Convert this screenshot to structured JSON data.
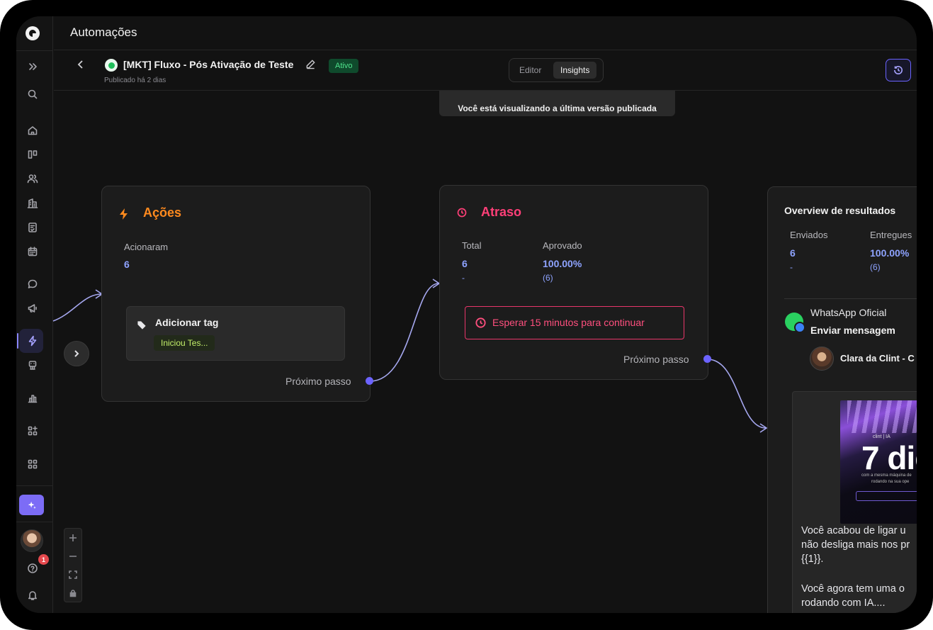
{
  "header": {
    "app_title": "Automações"
  },
  "flow": {
    "name": "[MKT] Fluxo - Pós Ativação de Teste",
    "status": "Ativo",
    "published": "Publicado há 2 dias"
  },
  "view_toggle": {
    "editor": "Editor",
    "insights": "Insights",
    "selected": "Insights"
  },
  "version_notice": "Você está visualizando a última versão publicada",
  "sidebar": {
    "badge_count": "1",
    "icons": [
      "expand-icon",
      "search-icon",
      "home-icon",
      "board-icon",
      "users-icon",
      "building-icon",
      "tasks-icon",
      "calendar-icon",
      "chat-icon",
      "megaphone-icon",
      "automation-icon",
      "bot-icon",
      "chart-icon",
      "apps-add-icon",
      "apps-icon",
      "ai-sparkle-icon",
      "help-icon",
      "bell-icon"
    ],
    "active": "automation-icon"
  },
  "nodes": {
    "acoes": {
      "title": "Ações",
      "label": "Acionaram",
      "value": "6",
      "tag_action": "Adicionar tag",
      "tag_chip": "Iniciou Tes...",
      "next": "Próximo passo",
      "color": "#ff8a1e"
    },
    "atraso": {
      "title": "Atraso",
      "total_label": "Total",
      "total_value": "6",
      "total_sub": "-",
      "approved_label": "Aprovado",
      "approved_value": "100.00%",
      "approved_sub": "(6)",
      "wait_text": "Esperar 15 minutos para continuar",
      "next": "Próximo passo",
      "color": "#ff3f78"
    },
    "overview": {
      "title": "Overview de resultados",
      "sent_label": "Enviados",
      "sent_value": "6",
      "sent_sub": "-",
      "delivered_label": "Entregues",
      "delivered_value": "100.00%",
      "delivered_sub": "(6)",
      "channel": "WhatsApp Oficial",
      "action": "Enviar mensagem",
      "sender": "Clara da Clint - C",
      "promo_brand": "clint | IA",
      "promo_big": "7 dic",
      "promo_small_1": "com a mesma máquina de",
      "promo_small_2": "rodando na sua ope",
      "message_1": "Você acabou de ligar u",
      "message_2": "não desliga mais nos pr",
      "message_3": "{{1}}.",
      "message_4": "Você agora tem uma o",
      "message_5": "rodando com IA...."
    }
  }
}
